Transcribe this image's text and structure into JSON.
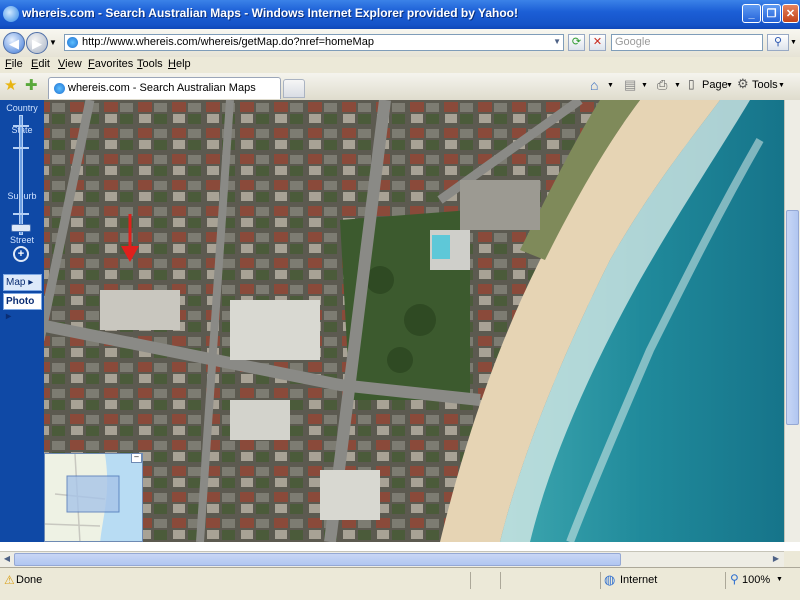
{
  "window": {
    "title": "whereis.com - Search Australian Maps - Windows Internet Explorer provided by Yahoo!"
  },
  "address_bar": {
    "url": "http://www.whereis.com/whereis/getMap.do?nref=homeMap"
  },
  "search": {
    "placeholder": "Google"
  },
  "menu": {
    "items": [
      "File",
      "Edit",
      "View",
      "Favorites",
      "Tools",
      "Help"
    ]
  },
  "tabs": [
    {
      "label": "whereis.com - Search Australian Maps"
    }
  ],
  "toolbar": {
    "page_label": "Page",
    "tools_label": "Tools"
  },
  "zoom": {
    "levels": [
      "Country",
      "State",
      "Suburb",
      "Street"
    ],
    "map_types": [
      "Map",
      "Photo"
    ],
    "selected_map_type": "Photo"
  },
  "status": {
    "text": "Done",
    "zone": "Internet",
    "zoom": "100%"
  },
  "colors": {
    "title_bar": "#1553c8",
    "zoom_panel": "#0f49a6",
    "marker": "#e0201c",
    "ocean": "#1f8c9c",
    "sand": "#e6d4b4"
  }
}
